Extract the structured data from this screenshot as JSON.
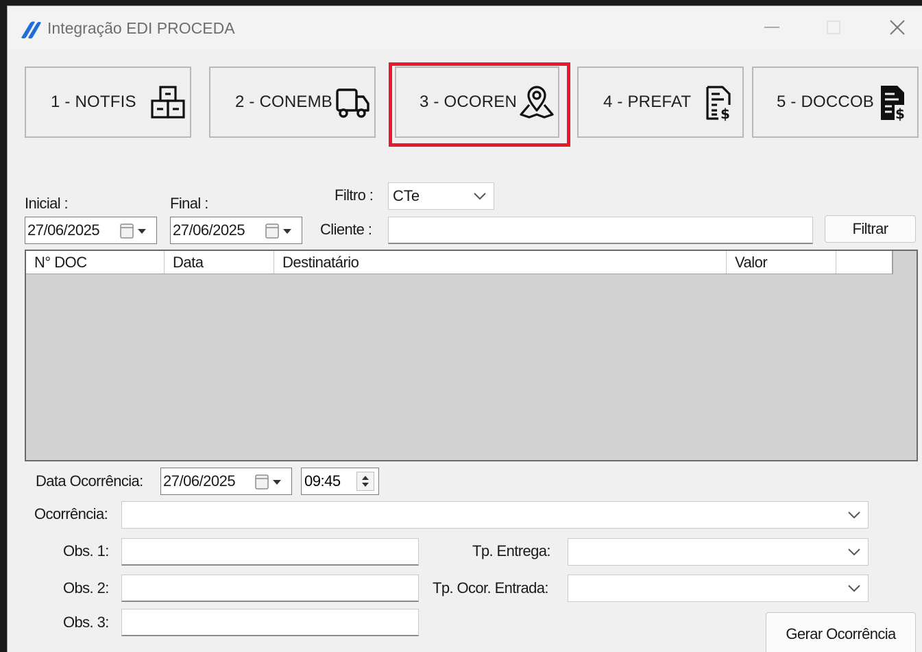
{
  "window": {
    "title": "Integração EDI PROCEDA"
  },
  "tabs": [
    {
      "label": "1 - NOTFIS",
      "icon": "boxes-icon"
    },
    {
      "label": "2 - CONEMB",
      "icon": "truck-icon"
    },
    {
      "label": "3 - OCOREN",
      "icon": "map-pin-icon",
      "highlighted": true
    },
    {
      "label": "4 - PREFAT",
      "icon": "invoice-icon"
    },
    {
      "label": "5 - DOCCOB",
      "icon": "billing-document-icon"
    }
  ],
  "filters": {
    "inicial_label": "Inicial :",
    "inicial_value": "27/06/2025",
    "final_label": "Final :",
    "final_value": "27/06/2025",
    "filtro_label": "Filtro :",
    "filtro_value": "CTe",
    "cliente_label": "Cliente :",
    "cliente_value": "",
    "filtrar_label": "Filtrar"
  },
  "grid": {
    "columns": [
      "N° DOC",
      "Data",
      "Destinatário",
      "Valor"
    ],
    "rows": []
  },
  "occurrence": {
    "data_label": "Data Ocorrência:",
    "data_value": "27/06/2025",
    "time_value": "09:45",
    "ocorrencia_label": "Ocorrência:",
    "ocorrencia_value": "",
    "obs1_label": "Obs. 1:",
    "obs2_label": "Obs. 2:",
    "obs3_label": "Obs. 3:",
    "tp_entrega_label": "Tp. Entrega:",
    "tp_entrega_value": "",
    "tp_ocor_entrada_label": "Tp. Ocor. Entrada:",
    "tp_ocor_entrada_value": "",
    "gerar_label": "Gerar Ocorrência"
  },
  "colors": {
    "highlight": "#e8192c",
    "logo": "#1e6fd9",
    "grid_bg": "#d3d3d3"
  }
}
